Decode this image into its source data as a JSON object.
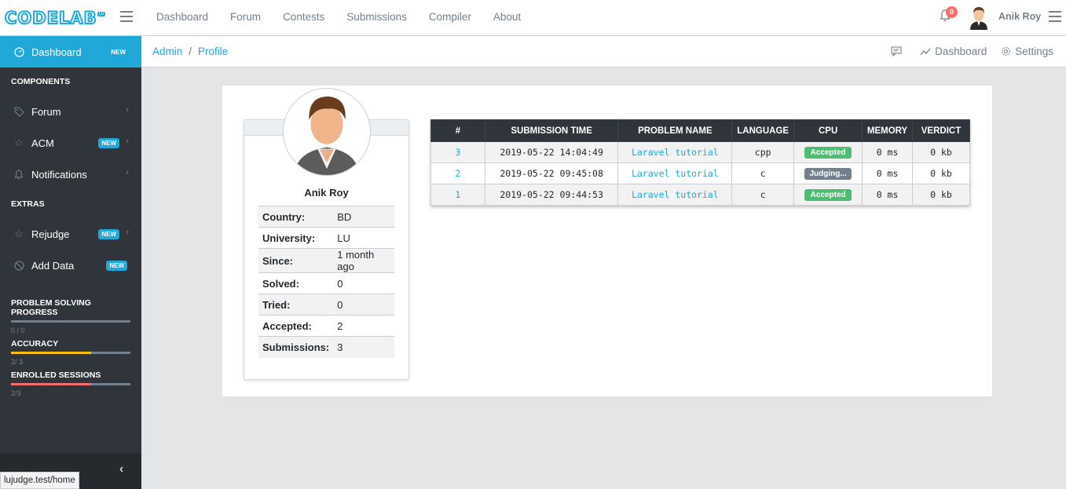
{
  "brand": {
    "logo_text": "CODELAB",
    "logo_tag": "LU"
  },
  "topnav": [
    "Dashboard",
    "Forum",
    "Contests",
    "Submissions",
    "Compiler",
    "About"
  ],
  "header": {
    "notification_count": "0",
    "user_name": "Anik Roy"
  },
  "sidebar": {
    "dashboard": {
      "label": "Dashboard",
      "badge": "NEW"
    },
    "components_title": "COMPONENTS",
    "forum": {
      "label": "Forum"
    },
    "acm": {
      "label": "ACM",
      "badge": "NEW"
    },
    "notifications": {
      "label": "Notifications"
    },
    "extras_title": "EXTRAS",
    "rejudge": {
      "label": "Rejudge",
      "badge": "NEW"
    },
    "add_data": {
      "label": "Add Data",
      "badge": "NEW"
    },
    "progress": [
      {
        "title": "PROBLEM SOLVING PROGRESS",
        "value": "0 / 0",
        "fraction": 0,
        "color": "#73818f"
      },
      {
        "title": "ACCURACY",
        "value": "2/ 3",
        "fraction": 0.67,
        "color": "#ffc107"
      },
      {
        "title": "ENROLLED SESSIONS",
        "value": "2/3",
        "fraction": 0.67,
        "color": "#f86c6b"
      }
    ]
  },
  "status_url": "lujudge.test/home",
  "breadcrumb": {
    "items": [
      "Admin",
      "Profile"
    ],
    "right": {
      "dashboard": "Dashboard",
      "settings": "Settings"
    }
  },
  "profile": {
    "name": "Anik Roy",
    "fields": [
      {
        "key": "Country:",
        "value": "BD"
      },
      {
        "key": "University:",
        "value": "LU"
      },
      {
        "key": "Since:",
        "value": "1 month ago"
      },
      {
        "key": "Solved:",
        "value": "0"
      },
      {
        "key": "Tried:",
        "value": "0"
      },
      {
        "key": "Accepted:",
        "value": "2"
      },
      {
        "key": "Submissions:",
        "value": "3"
      }
    ]
  },
  "submissions": {
    "headers": [
      "#",
      "SUBMISSION TIME",
      "PROBLEM NAME",
      "LANGUAGE",
      "CPU",
      "MEMORY",
      "VERDICT"
    ],
    "rows": [
      {
        "id": "3",
        "time": "2019-05-22 14:04:49",
        "problem": "Laravel tutorial",
        "language": "cpp",
        "status": "Accepted",
        "status_color": "#4dbd74",
        "memory": "0 ms",
        "verdict": "0 kb"
      },
      {
        "id": "2",
        "time": "2019-05-22 09:45:08",
        "problem": "Laravel tutorial",
        "language": "c",
        "status": "Judging...",
        "status_color": "#73818f",
        "memory": "0 ms",
        "verdict": "0 kb"
      },
      {
        "id": "1",
        "time": "2019-05-22 09:44:53",
        "problem": "Laravel tutorial",
        "language": "c",
        "status": "Accepted",
        "status_color": "#4dbd74",
        "memory": "0 ms",
        "verdict": "0 kb"
      }
    ]
  },
  "colors": {
    "primary": "#20a8d8",
    "sidebar": "#2f353a",
    "success": "#4dbd74",
    "secondary": "#73818f"
  }
}
